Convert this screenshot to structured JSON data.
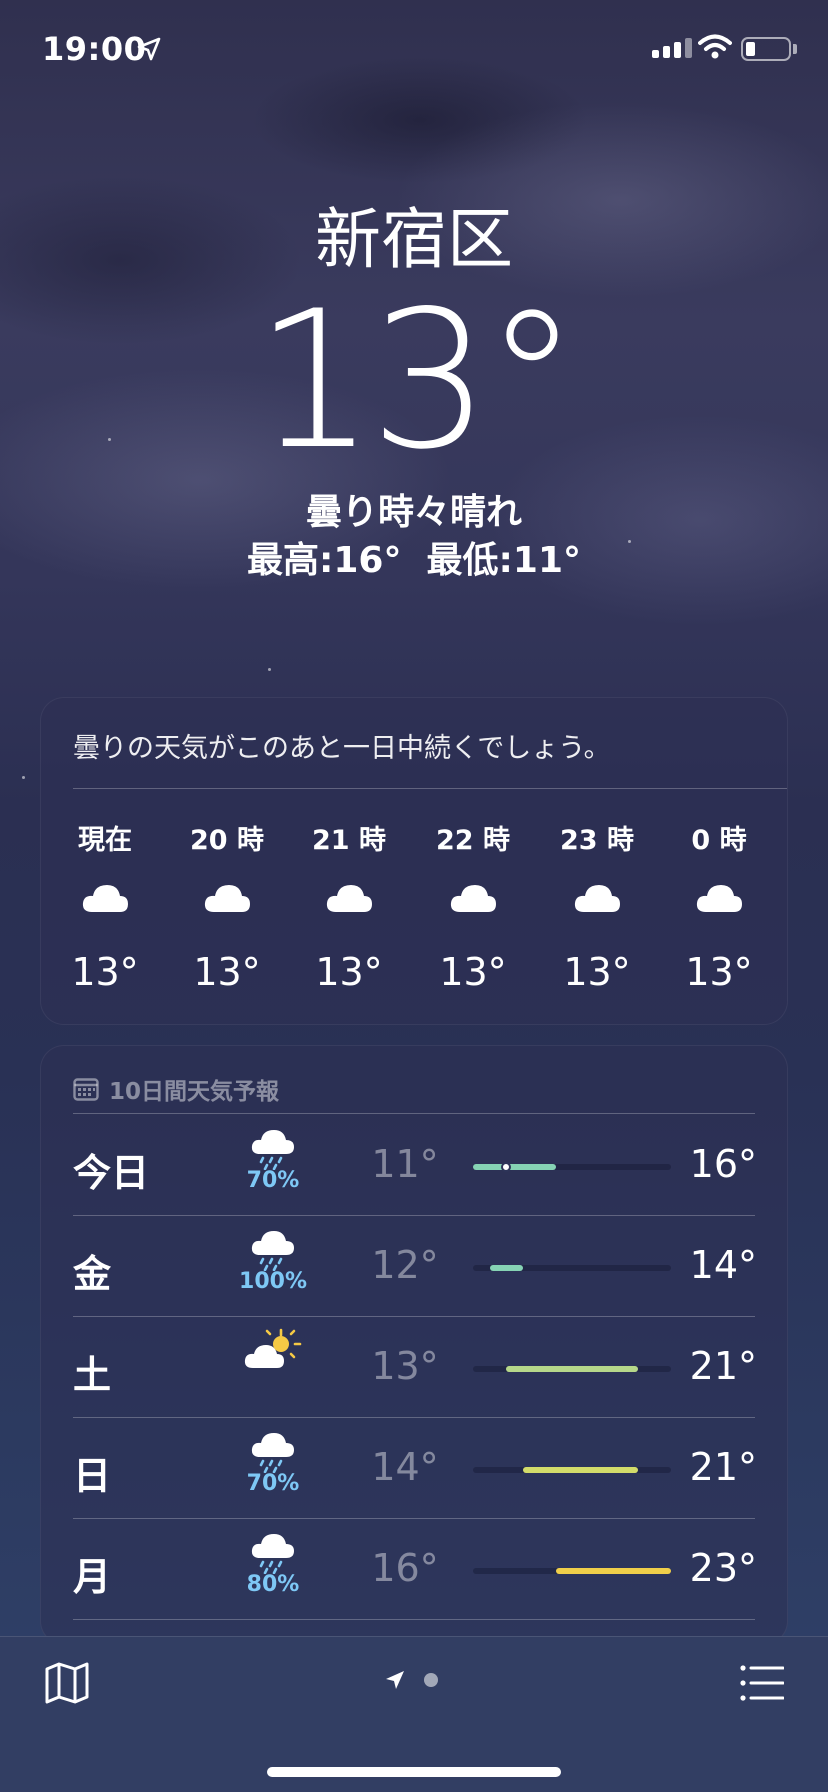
{
  "status_bar": {
    "time": "19:00",
    "icons": [
      "location-arrow-icon",
      "cellular-signal-icon",
      "wifi-icon",
      "battery-icon"
    ],
    "battery_level": 0.2
  },
  "header": {
    "location": "新宿区",
    "temperature": "13°",
    "condition": "曇り時々晴れ",
    "hilo": "最高:16°  最低:11°"
  },
  "hourly": {
    "summary": "曇りの天気がこのあと一日中続くでしょう。",
    "hours": [
      {
        "label": "現在",
        "icon": "cloud-icon",
        "temp": "13°"
      },
      {
        "label": "20 時",
        "icon": "cloud-icon",
        "temp": "13°"
      },
      {
        "label": "21 時",
        "icon": "cloud-icon",
        "temp": "13°"
      },
      {
        "label": "22 時",
        "icon": "cloud-icon",
        "temp": "13°"
      },
      {
        "label": "23 時",
        "icon": "cloud-icon",
        "temp": "13°"
      },
      {
        "label": "0 時",
        "icon": "cloud-icon",
        "temp": "13°"
      }
    ]
  },
  "daily": {
    "title": "10日間天気予報",
    "title_icon": "calendar-icon",
    "range_min": 11,
    "range_max": 23,
    "current_temp": 13,
    "days": [
      {
        "name": "今日",
        "icon": "cloud-rain-icon",
        "pop": "70%",
        "low": "11°",
        "high": "16°",
        "low_val": 11,
        "high_val": 16,
        "color": "#86d3b4"
      },
      {
        "name": "金",
        "icon": "cloud-rain-icon",
        "pop": "100%",
        "low": "12°",
        "high": "14°",
        "low_val": 12,
        "high_val": 14,
        "color": "#86d3b4"
      },
      {
        "name": "土",
        "icon": "cloud-sun-icon",
        "pop": "",
        "low": "13°",
        "high": "21°",
        "low_val": 13,
        "high_val": 21,
        "color": "#b6d88a"
      },
      {
        "name": "日",
        "icon": "cloud-rain-icon",
        "pop": "70%",
        "low": "14°",
        "high": "21°",
        "low_val": 14,
        "high_val": 21,
        "color": "#d3dc6a"
      },
      {
        "name": "月",
        "icon": "cloud-rain-icon",
        "pop": "80%",
        "low": "16°",
        "high": "23°",
        "low_val": 16,
        "high_val": 23,
        "color": "#f0cf4a"
      }
    ]
  },
  "toolbar": {
    "left_icon": "map-icon",
    "center_icons": [
      "location-arrow-icon",
      "page-dot-icon"
    ],
    "right_icon": "list-icon"
  },
  "colors": {
    "pop_blue": "#7ec8f5",
    "sun_yellow": "#f5c945"
  }
}
